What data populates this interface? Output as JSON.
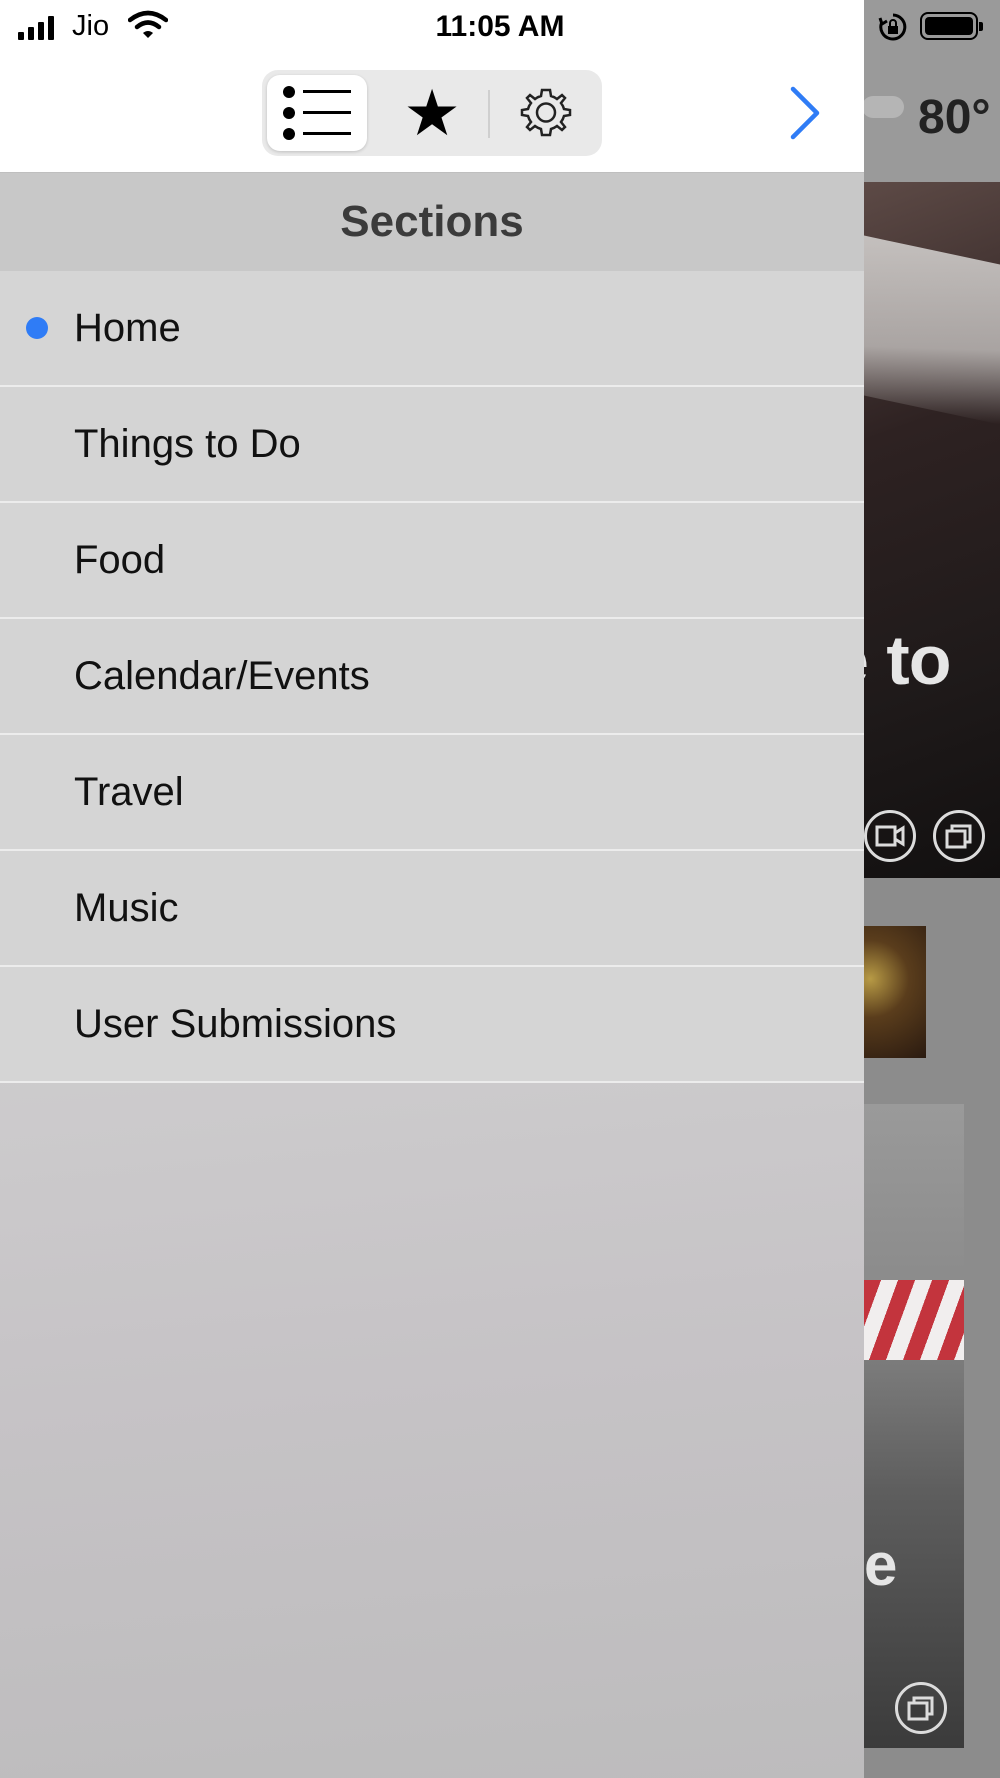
{
  "status_bar": {
    "carrier": "Jio",
    "time": "11:05 AM"
  },
  "toolbar": {
    "tabs": [
      {
        "icon": "list-icon",
        "selected": true
      },
      {
        "icon": "star-icon",
        "selected": false
      },
      {
        "icon": "gear-icon",
        "selected": false
      }
    ],
    "forward_icon": "chevron-right-icon"
  },
  "drawer": {
    "header": "Sections",
    "items": [
      {
        "label": "Home",
        "active": true
      },
      {
        "label": "Things to Do",
        "active": false
      },
      {
        "label": "Food",
        "active": false
      },
      {
        "label": "Calendar/Events",
        "active": false
      },
      {
        "label": "Travel",
        "active": false
      },
      {
        "label": "Music",
        "active": false
      },
      {
        "label": "User Submissions",
        "active": false
      }
    ]
  },
  "background": {
    "weather": "80°",
    "hero_text": "e to",
    "card_text": "e"
  },
  "colors": {
    "accent": "#2f7cf6",
    "drawer_bg": "#d5d5d5",
    "header_bg": "#c8c8c8"
  }
}
